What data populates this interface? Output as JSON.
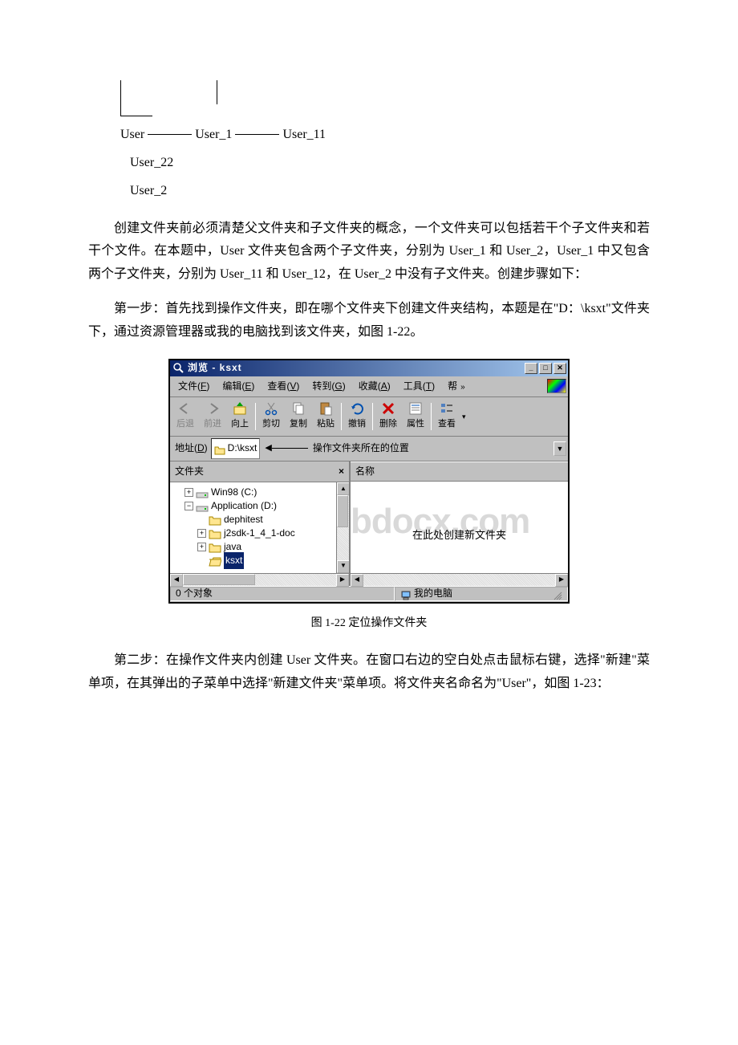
{
  "hierarchy": {
    "line1_a": "User",
    "line1_b": "User_1",
    "line1_c": "User_11",
    "line2": "User_22",
    "line3": "User_2"
  },
  "para1": "创建文件夹前必须清楚父文件夹和子文件夹的概念，一个文件夹可以包括若干个子文件夹和若干个文件。在本题中，User 文件夹包含两个子文件夹，分别为 User_1 和 User_2，User_1 中又包含两个子文件夹，分别为 User_11 和 User_12，在 User_2 中没有子文件夹。创建步骤如下：",
  "para2": "第一步：首先找到操作文件夹，即在哪个文件夹下创建文件夹结构，本题是在\"D：\\ksxt\"文件夹下，通过资源管理器或我的电脑找到该文件夹，如图 1-22。",
  "win": {
    "title": "浏览 - ksxt",
    "menus": {
      "file": "文件(F)",
      "edit": "编辑(E)",
      "view": "查看(V)",
      "goto": "转到(G)",
      "fav": "收藏(A)",
      "tools": "工具(T)",
      "help": "帮"
    },
    "toolbar": {
      "back": "后退",
      "forward": "前进",
      "up": "向上",
      "cut": "剪切",
      "copy": "复制",
      "paste": "粘贴",
      "undo": "撤销",
      "delete": "删除",
      "props": "属性",
      "views": "查看"
    },
    "address": {
      "label": "地址(D)",
      "value": "D:\\ksxt",
      "note": "操作文件夹所在的位置"
    },
    "panel": {
      "folders": "文件夹",
      "tree": {
        "c": "Win98 (C:)",
        "d": "Application (D:)",
        "d1": "dephitest",
        "d2": "j2sdk-1_4_1-doc",
        "d3": "java",
        "d4": "ksxt"
      },
      "name_header": "名称",
      "watermark": "bdocx.com",
      "create_here": "在此处创建新文件夹"
    },
    "status": {
      "objects": "0 个对象",
      "location": "我的电脑"
    }
  },
  "caption1": "图 1-22 定位操作文件夹",
  "para3": "第二步：在操作文件夹内创建 User 文件夹。在窗口右边的空白处点击鼠标右键，选择\"新建\"菜单项，在其弹出的子菜单中选择\"新建文件夹\"菜单项。将文件夹名命名为\"User\"，如图 1-23："
}
